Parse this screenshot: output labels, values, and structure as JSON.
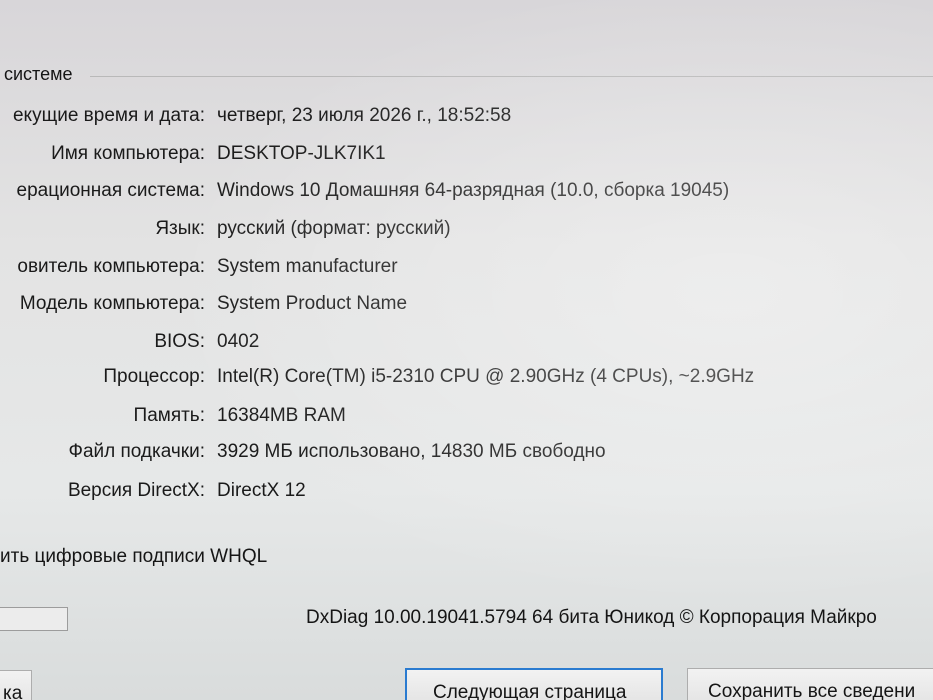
{
  "group": {
    "label": "системе"
  },
  "info_rows": [
    {
      "label": "екущие время и дата:",
      "value": "четверг, 23 июля 2026 г., 18:52:58"
    },
    {
      "label": "Имя компьютера:",
      "value": "DESKTOP-JLK7IK1"
    },
    {
      "label": "ерационная система:",
      "value": "Windows 10 Домашняя 64-разрядная (10.0, сборка 19045)"
    },
    {
      "label": "Язык:",
      "value": "русский (формат: русский)"
    },
    {
      "label": "овитель компьютера:",
      "value": "System manufacturer"
    },
    {
      "label": "Модель компьютера:",
      "value": "System Product Name"
    },
    {
      "label": "BIOS:",
      "value": "0402"
    },
    {
      "label": "Процессор:",
      "value": "Intel(R) Core(TM) i5-2310 CPU @ 2.90GHz (4 CPUs), ~2.9GHz"
    },
    {
      "label": "Память:",
      "value": "16384MB RAM"
    },
    {
      "label": "Файл подкачки:",
      "value": "3929 МБ использовано, 14830 МБ свободно"
    },
    {
      "label": "Версия DirectX:",
      "value": "DirectX 12"
    }
  ],
  "whql_checkbox_label": "ить цифровые подписи WHQL",
  "dxdiag_version": "DxDiag 10.00.19041.5794 64 бита Юникод © Корпорация Майкро",
  "buttons": {
    "left_partial": "ка",
    "next_page": "Следующая страница",
    "save_all": "Сохранить все сведени"
  }
}
